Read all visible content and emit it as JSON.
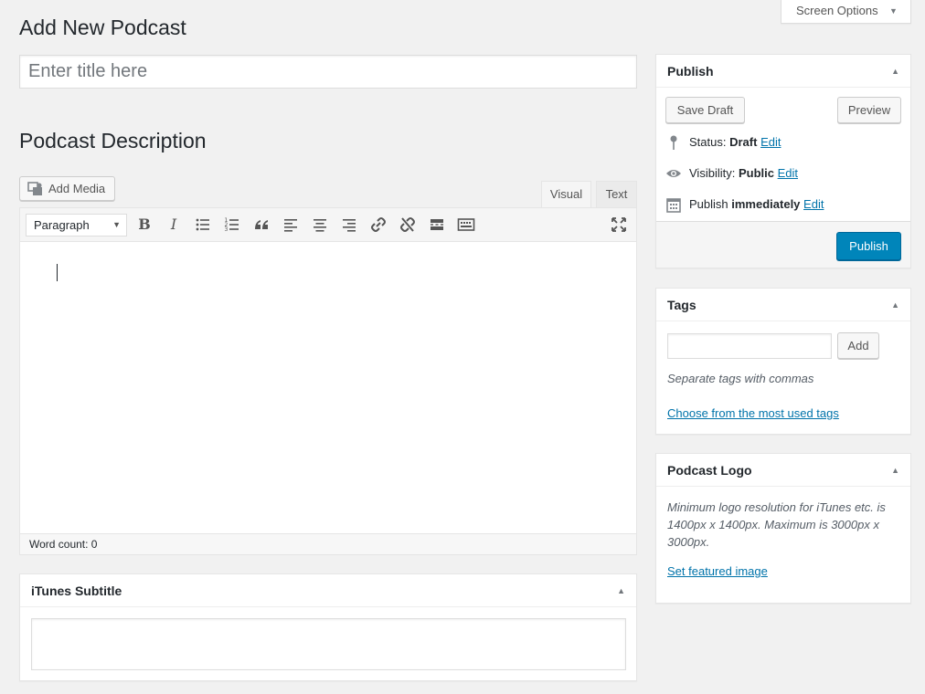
{
  "screen_options": {
    "label": "Screen Options"
  },
  "page": {
    "title": "Add New Podcast"
  },
  "title_field": {
    "placeholder": "Enter title here",
    "value": ""
  },
  "description": {
    "heading": "Podcast Description",
    "add_media_label": "Add Media",
    "tabs": [
      {
        "label": "Visual",
        "active": true
      },
      {
        "label": "Text",
        "active": false
      }
    ],
    "format_select": "Paragraph",
    "toolbar": [
      "bold",
      "italic",
      "bulleted-list",
      "numbered-list",
      "blockquote",
      "align-left",
      "align-center",
      "align-right",
      "insert-link",
      "remove-link",
      "read-more",
      "toolbar-toggle",
      "fullscreen"
    ],
    "word_count_label": "Word count: 0"
  },
  "itunes_subtitle": {
    "title": "iTunes Subtitle",
    "value": ""
  },
  "publish": {
    "title": "Publish",
    "save_draft_label": "Save Draft",
    "preview_label": "Preview",
    "status_label": "Status:",
    "status_value": "Draft",
    "visibility_label": "Visibility:",
    "visibility_value": "Public",
    "schedule_label": "Publish",
    "schedule_value": "immediately",
    "edit_label": "Edit",
    "publish_button_label": "Publish"
  },
  "tags": {
    "title": "Tags",
    "add_label": "Add",
    "hint": "Separate tags with commas",
    "most_used_link": "Choose from the most used tags"
  },
  "podcast_logo": {
    "title": "Podcast Logo",
    "hint": "Minimum logo resolution for iTunes etc. is 1400px x 1400px. Maximum is 3000px x 3000px.",
    "set_image_link": "Set featured image"
  },
  "colors": {
    "primary": "#0085ba",
    "link": "#0073aa",
    "background": "#f1f1f1"
  }
}
